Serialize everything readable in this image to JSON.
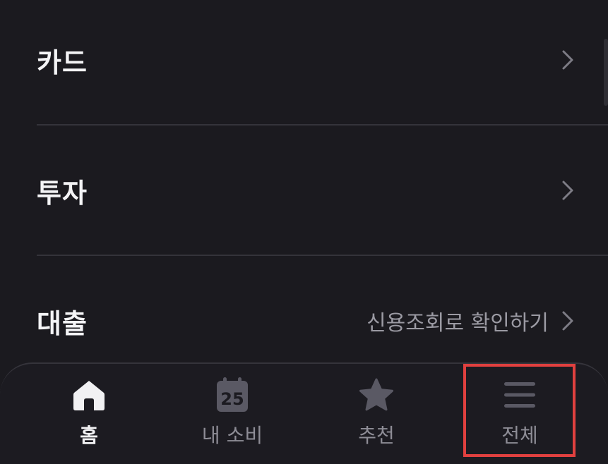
{
  "menu": {
    "items": [
      {
        "label": "카드",
        "hint": ""
      },
      {
        "label": "투자",
        "hint": ""
      },
      {
        "label": "대출",
        "hint": "신용조회로 확인하기"
      }
    ]
  },
  "tabbar": {
    "tabs": [
      {
        "label": "홈",
        "icon": "home-icon",
        "active": true
      },
      {
        "label": "내 소비",
        "icon": "calendar-icon",
        "calendar_day": "25",
        "active": false
      },
      {
        "label": "추천",
        "icon": "star-icon",
        "active": false
      },
      {
        "label": "전체",
        "icon": "menu-icon",
        "active": false
      }
    ]
  },
  "colors": {
    "background": "#1b1a1f",
    "text_primary": "#f4f4f6",
    "text_secondary": "#9b9aa3",
    "tab_inactive": "#5a5964",
    "highlight": "#e0403f"
  }
}
